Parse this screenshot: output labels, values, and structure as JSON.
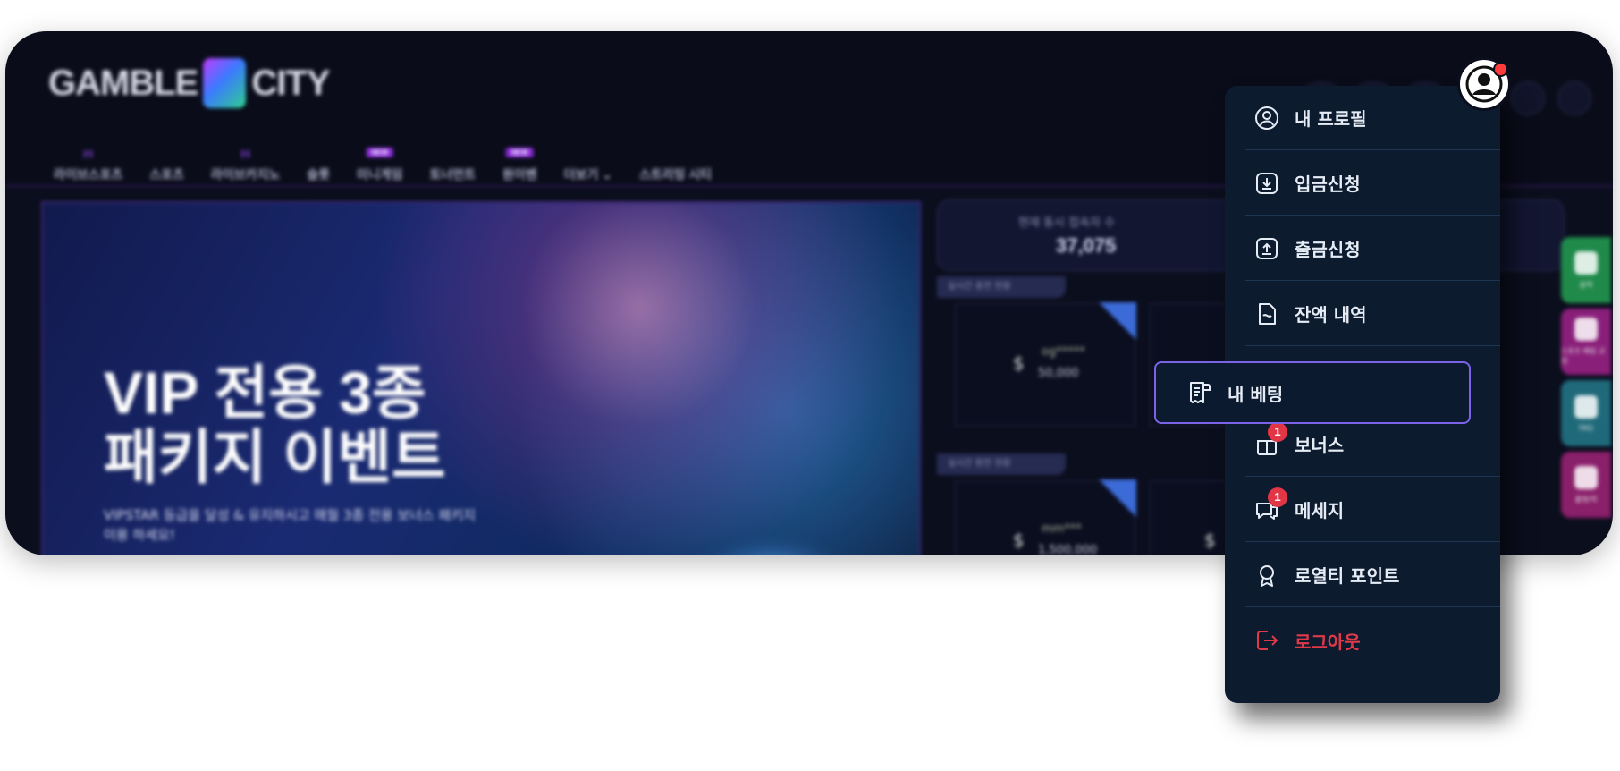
{
  "site": {
    "logo_left": "GAMBLE",
    "logo_right": "CITY",
    "nav": [
      {
        "label": "라이브스포츠",
        "tag": "(•)"
      },
      {
        "label": "스포츠",
        "tag": ""
      },
      {
        "label": "라이브카지노",
        "tag": "(•)"
      },
      {
        "label": "슬롯",
        "tag": ""
      },
      {
        "label": "미니게임",
        "tag": "NEW"
      },
      {
        "label": "토너먼트",
        "tag": ""
      },
      {
        "label": "원이벤",
        "tag": "NEW"
      },
      {
        "label": "더보기 ⌄",
        "tag": ""
      },
      {
        "label": "스트리밍 시티",
        "tag": ""
      }
    ],
    "hero": {
      "title_line1": "VIP 전용 3종",
      "title_line2": "패키지 이벤트",
      "subtitle": "VIPSTAR 등급을 달성 & 유지하시고 매월 3종 전용 보너스 패키지 이용 하세요!"
    },
    "stats": {
      "concurrent_label": "현재 동시 접속자 수",
      "concurrent_value": "37,075",
      "section1_label": "실시간 충전 현황",
      "section2_label": "실시간 환전 현황",
      "win1_name": "og*****",
      "win1_amount": "50,000",
      "win2_name": "mm***",
      "win2_amount": "1,500,000"
    },
    "side_rail": [
      {
        "label": "출첵",
        "color": "#1f8a4a"
      },
      {
        "label": "스포츠 배팅 규정",
        "color": "#8a1f7a"
      },
      {
        "label": "FAQ",
        "color": "#1f6a7a"
      },
      {
        "label": "룰렛/럭",
        "color": "#8a1f6a"
      }
    ]
  },
  "menu": {
    "items": [
      {
        "label": "내 프로필",
        "icon": "profile-icon"
      },
      {
        "label": "입금신청",
        "icon": "deposit-icon"
      },
      {
        "label": "출금신청",
        "icon": "withdraw-icon"
      },
      {
        "label": "잔액 내역",
        "icon": "balance-history-icon"
      },
      {
        "label": "내 베팅",
        "icon": "bet-receipt-icon"
      },
      {
        "label": "보너스",
        "icon": "gift-icon",
        "badge": "1"
      },
      {
        "label": "메세지",
        "icon": "message-icon",
        "badge": "1"
      },
      {
        "label": "로열티 포인트",
        "icon": "award-icon"
      },
      {
        "label": "로그아웃",
        "icon": "logout-icon"
      }
    ]
  }
}
